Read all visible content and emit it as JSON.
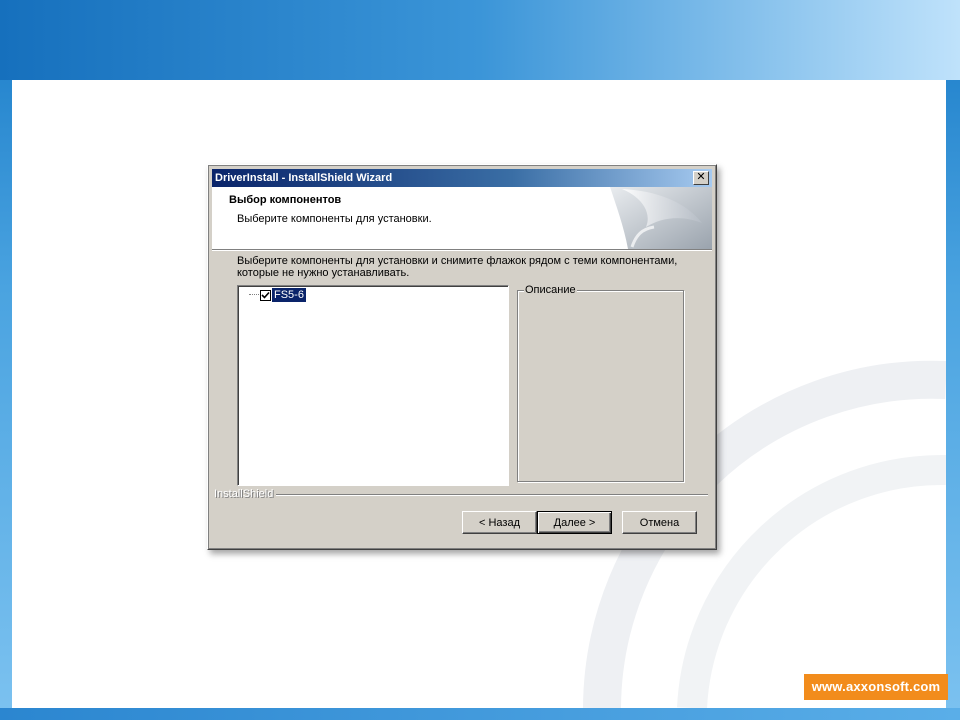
{
  "window": {
    "title": "DriverInstall - InstallShield Wizard",
    "close_glyph": "✕"
  },
  "header": {
    "title": "Выбор компонентов",
    "subtitle": "Выберите компоненты для установки."
  },
  "body": {
    "instruction": "Выберите компоненты для установки и снимите флажок рядом с теми компонентами, которые не нужно устанавливать.",
    "components": [
      {
        "label": "FS5-6",
        "checked": true,
        "selected": true
      }
    ],
    "description_group": {
      "legend": "Описание",
      "text": ""
    }
  },
  "footer": {
    "brand": "InstallShield",
    "buttons": {
      "back": "< Назад",
      "next": "Далее >",
      "cancel": "Отмена"
    }
  },
  "slide": {
    "url": "www.axxonsoft.com",
    "accent_color": "#f28c1c",
    "title_color": "#0a246a"
  }
}
